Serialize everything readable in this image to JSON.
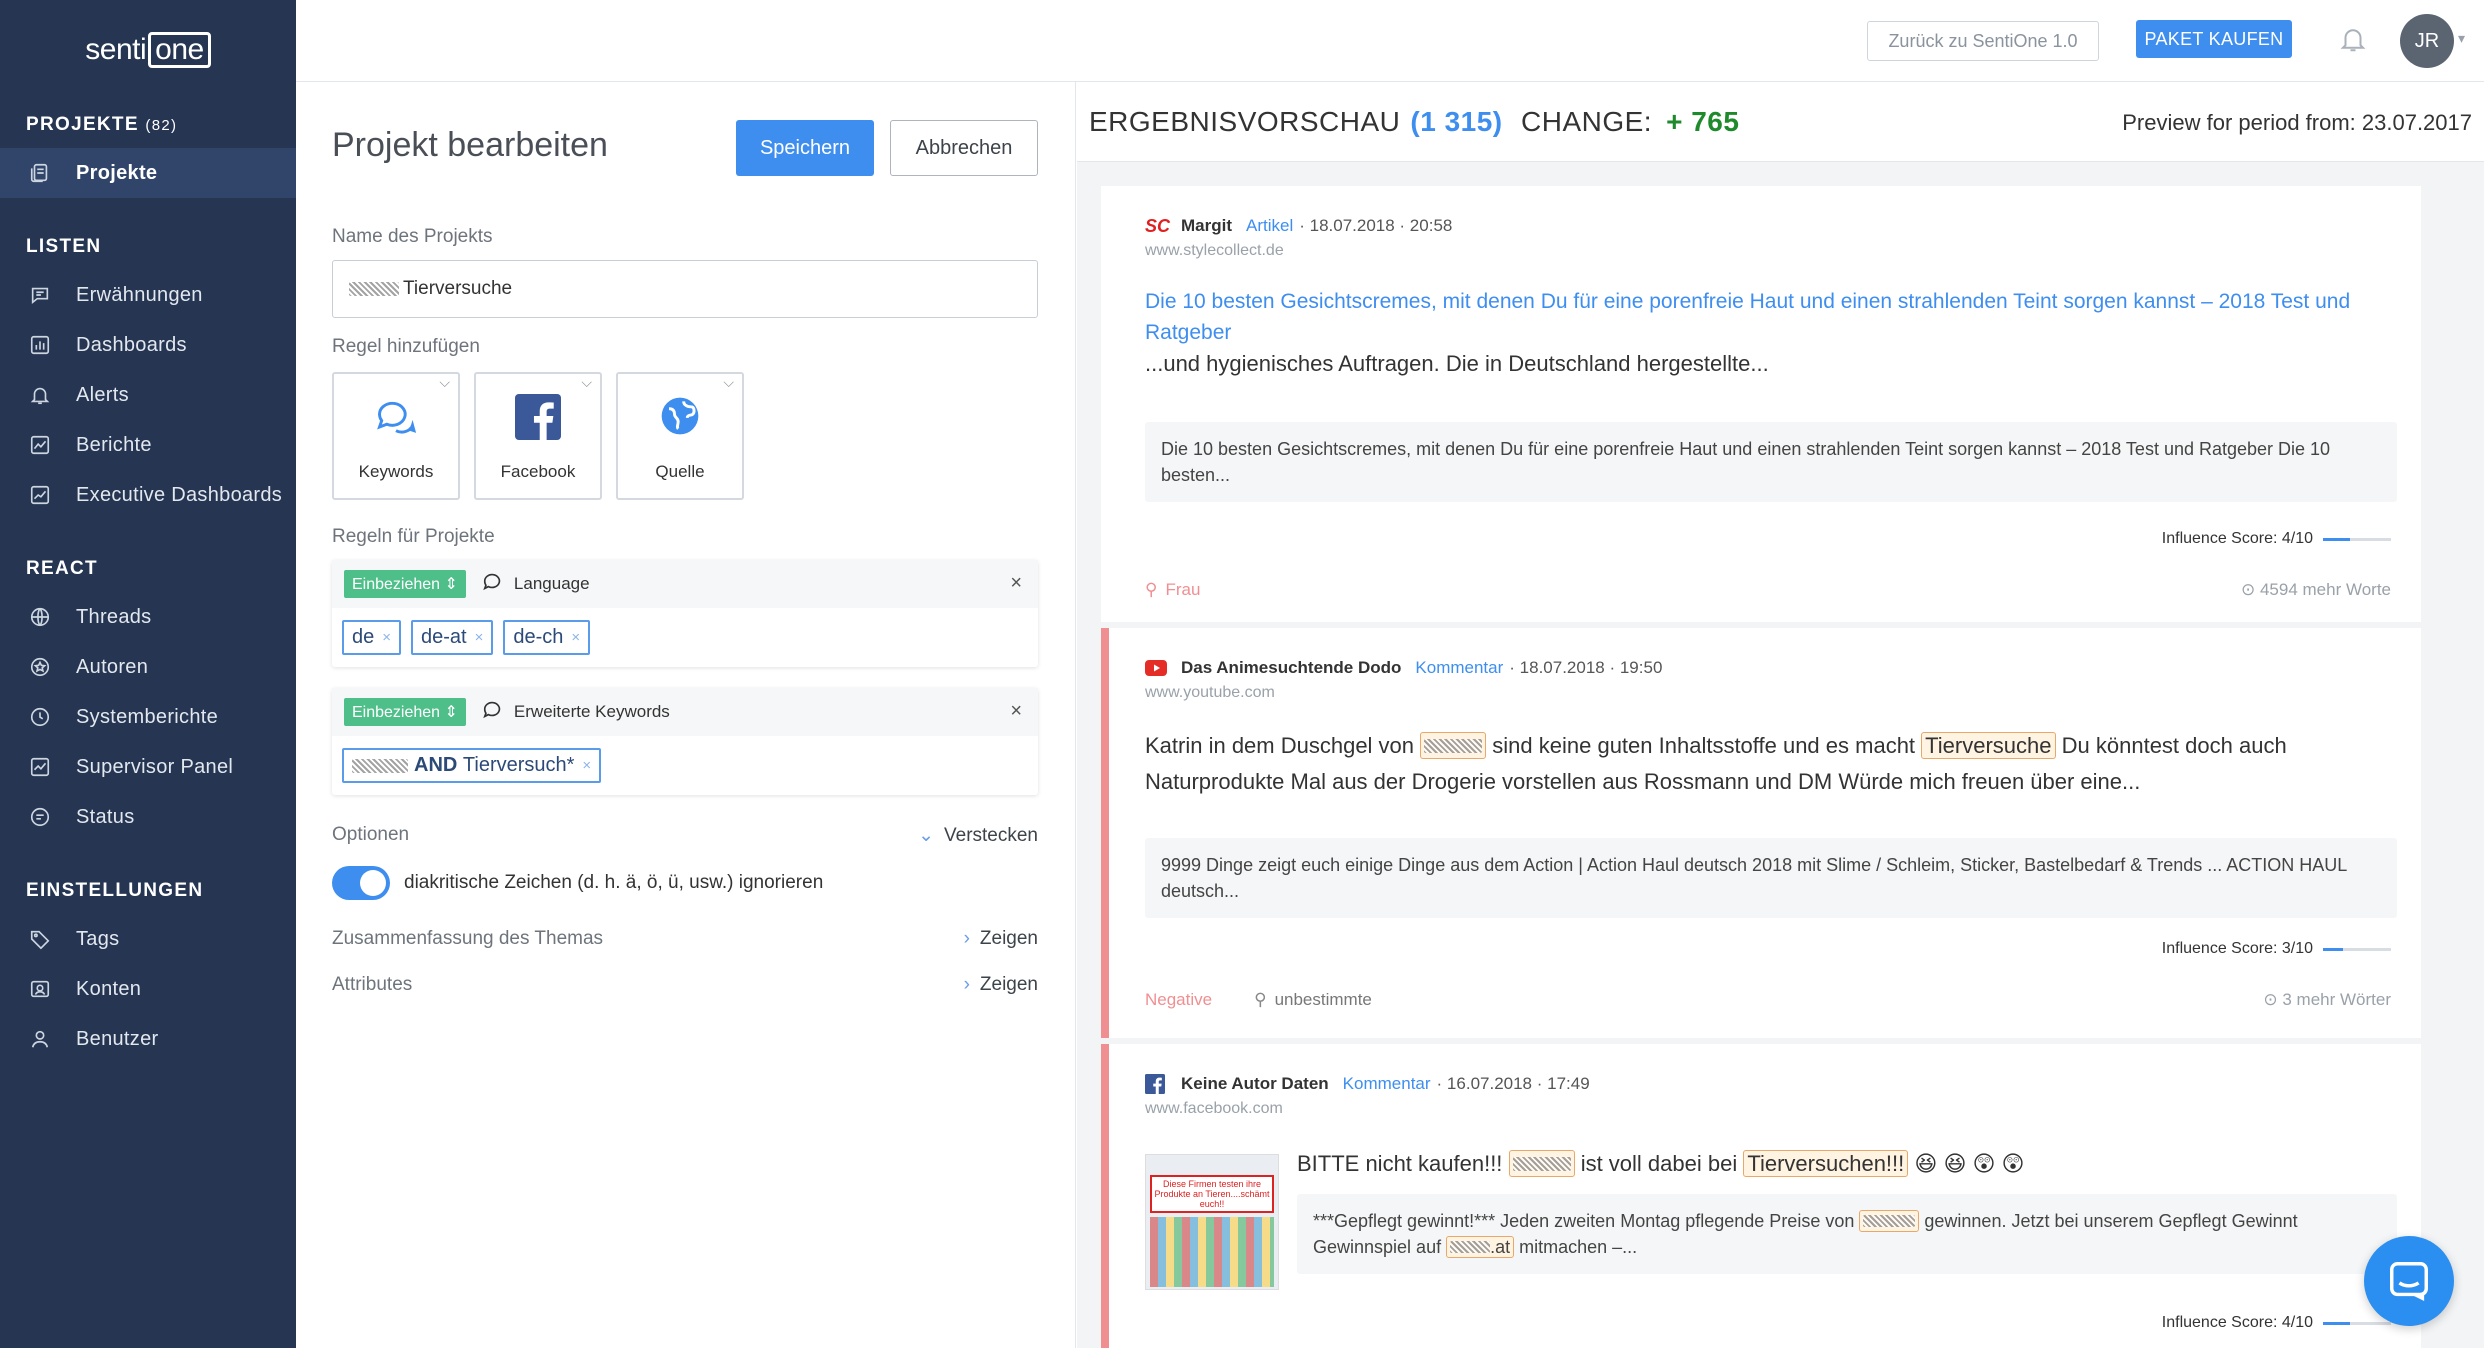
{
  "brand": {
    "logo_text": "senti",
    "logo_box": "one"
  },
  "sidebar": {
    "projects_title": "PROJEKTE",
    "projects_count": "(82)",
    "projects_item": "Projekte",
    "lists_title": "LISTEN",
    "lists": [
      "Erwähnungen",
      "Dashboards",
      "Alerts",
      "Berichte",
      "Executive Dashboards"
    ],
    "react_title": "REACT",
    "react": [
      "Threads",
      "Autoren",
      "Systemberichte",
      "Supervisor Panel",
      "Status"
    ],
    "settings_title": "EINSTELLUNGEN",
    "settings": [
      "Tags",
      "Konten",
      "Benutzer"
    ]
  },
  "topbar": {
    "back_label": "Zurück zu SentiOne 1.0",
    "buy_label": "PAKET KAUFEN",
    "avatar": "JR"
  },
  "form": {
    "title": "Projekt bearbeiten",
    "save": "Speichern",
    "cancel": "Abbrechen",
    "name_label": "Name des Projekts",
    "name_value": "Tierversuche",
    "add_rule_label": "Regel hinzufügen",
    "rule_cards": [
      "Keywords",
      "Facebook",
      "Quelle"
    ],
    "rules_label": "Regeln für Projekte",
    "rule1": {
      "badge": "Einbeziehen ⇕",
      "title": "Language",
      "chips": [
        "de",
        "de-at",
        "de-ch"
      ]
    },
    "rule2": {
      "badge": "Einbeziehen ⇕",
      "title": "Erweiterte Keywords",
      "chip_and": "AND",
      "chip_rest": "Tierversuch*"
    },
    "options_label": "Optionen",
    "hide_label": "Verstecken",
    "toggle_label": "diakritische Zeichen (d. h. ä, ö, ü, usw.) ignorieren",
    "summary_label": "Zusammenfassung des Themas",
    "show_label": "Zeigen",
    "attributes_label": "Attributes"
  },
  "results": {
    "title": "ERGEBNISVORSCHAU",
    "count": "(1 315)",
    "change_label": "CHANGE:",
    "change_value": "+ 765",
    "preview": "Preview for period from: 23.07.2017"
  },
  "cards": [
    {
      "author": "Margit",
      "type": "Artikel",
      "date": "· 18.07.2018 · 20:58",
      "site": "www.stylecollect.de",
      "headline": "Die 10 besten Gesichtscremes, mit denen Du für eine porenfreie Haut und einen strahlenden Teint sorgen kannst – 2018 Test und Ratgeber",
      "body": "...und hygienisches Auftragen. Die in Deutschland hergestellte...",
      "quote": "Die 10 besten Gesichtscremes, mit denen Du für eine porenfreie Haut und einen strahlenden Teint sorgen kannst – 2018 Test und Ratgeber Die 10 besten...",
      "influence": "Influence Score: 4/10",
      "influence_level": 0.4,
      "tag": "Frau",
      "more": "4594 mehr Worte"
    },
    {
      "author": "Das Animesuchtende Dodo",
      "type": "Kommentar",
      "date": "· 18.07.2018 · 19:50",
      "site": "www.youtube.com",
      "body_a": "Katrin in dem Duschgel von",
      "body_b": "sind keine guten Inhaltsstoffe und es macht",
      "body_hl": "Tierversuche",
      "body_c": "Du könntest doch auch Naturprodukte Mal aus der Drogerie vorstellen aus Rossmann und DM Würde mich freuen über eine...",
      "quote": "9999 Dinge zeigt euch einige Dinge aus dem Action | Action Haul deutsch 2018 mit Slime / Schleim, Sticker, Bastelbedarf & Trends ... ACTION HAUL deutsch...",
      "influence": "Influence Score: 3/10",
      "influence_level": 0.3,
      "sentiment": "Negative",
      "gender": "unbestimmte",
      "more": "3 mehr Wörter"
    },
    {
      "author": "Keine Autor Daten",
      "type": "Kommentar",
      "date": "· 16.07.2018 · 17:49",
      "site": "www.facebook.com",
      "body_a": "BITTE nicht kaufen!!!",
      "body_b": "ist voll dabei bei",
      "body_hl": "Tierversuchen!!!",
      "emojis": "😆 😆 😲 😲",
      "quote_a": "***Gepflegt gewinnt!*** Jeden zweiten Montag pflegende Preise von",
      "quote_b": "gewinnen. Jetzt bei unserem Gepflegt Gewinnt Gewinnspiel auf",
      "quote_hl": ".at",
      "quote_c": "mitmachen –...",
      "thumb_text": "Diese Firmen testen ihre Produkte an Tieren....schämt euch!!",
      "influence": "Influence Score: 4/10",
      "influence_level": 0.4
    }
  ],
  "colors": {
    "sidebar": "#253552",
    "accent": "#3e8ef0",
    "include": "#4fbf8a",
    "negative": "#f08f92",
    "change": "#1f8a2c"
  }
}
